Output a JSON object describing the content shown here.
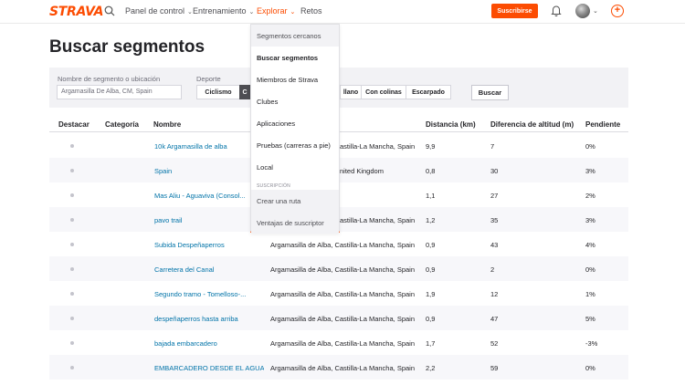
{
  "nav": {
    "logo": "STRAVA",
    "items": [
      {
        "label": "Panel de control",
        "caret": "⌄"
      },
      {
        "label": "Entrenamiento",
        "caret": "⌄"
      },
      {
        "label": "Explorar",
        "caret": "⌄"
      },
      {
        "label": "Retos"
      }
    ],
    "subscribe_label": "Suscribirse",
    "plus_label": "+",
    "accent_color": "#fc4c02"
  },
  "page": {
    "title": "Buscar segmentos"
  },
  "filters": {
    "segment_label": "Nombre de segmento o ubicación",
    "segment_value": "Argamasilla De Alba, CM, Spain",
    "sport_label": "Deporte",
    "sport_buttons": [
      "Ciclismo",
      "C"
    ],
    "terrain_buttons": [
      "llano",
      "Con colinas",
      "Escarpado"
    ],
    "search_label": "Buscar"
  },
  "table": {
    "columns": [
      "Destacar",
      "Categoría",
      "Nombre",
      "Distancia (km)",
      "Diferencia de altitud (m)",
      "Pendiente"
    ],
    "rows": [
      {
        "name": "10k Argamasilla de alba",
        "location": "astilla-La Mancha, Spain",
        "distance": "9,9",
        "elevation": "7",
        "grade": "0%"
      },
      {
        "name": "Spain",
        "location": "nited Kingdom",
        "distance": "0,8",
        "elevation": "30",
        "grade": "3%"
      },
      {
        "name": "Mas Aliu - Aguaviva (Consol...",
        "location": "",
        "distance": "1,1",
        "elevation": "27",
        "grade": "2%"
      },
      {
        "name": "pavo trail",
        "location": "astilla-La Mancha, Spain",
        "distance": "1,2",
        "elevation": "35",
        "grade": "3%"
      },
      {
        "name": "Subida Despeñaperros",
        "location": "Argamasilla de Alba, Castilla-La Mancha, Spain",
        "distance": "0,9",
        "elevation": "43",
        "grade": "4%"
      },
      {
        "name": "Carretera del Canal",
        "location": "Argamasilla de Alba, Castilla-La Mancha, Spain",
        "distance": "0,9",
        "elevation": "2",
        "grade": "0%"
      },
      {
        "name": "Segundo tramo - Tomelloso-...",
        "location": "Argamasilla de Alba, Castilla-La Mancha, Spain",
        "distance": "1,9",
        "elevation": "12",
        "grade": "1%"
      },
      {
        "name": "despeñaperros hasta arriba",
        "location": "Argamasilla de Alba, Castilla-La Mancha, Spain",
        "distance": "0,9",
        "elevation": "47",
        "grade": "5%"
      },
      {
        "name": "bajada embarcadero",
        "location": "Argamasilla de Alba, Castilla-La Mancha, Spain",
        "distance": "1,7",
        "elevation": "52",
        "grade": "-3%"
      },
      {
        "name": "EMBARCADERO DESDE EL AGUA",
        "location": "Argamasilla de Alba, Castilla-La Mancha, Spain",
        "distance": "2,2",
        "elevation": "59",
        "grade": "0%"
      }
    ]
  },
  "dropdown": {
    "items": [
      "Segmentos cercanos",
      "Buscar segmentos",
      "Miembros de Strava",
      "Clubes",
      "Aplicaciones",
      "Pruebas (carreras a pie)",
      "Local"
    ],
    "section_label": "SUSCRIPCIÓN",
    "sub_items": [
      "Crear una ruta",
      "Ventajas de suscriptor"
    ]
  }
}
